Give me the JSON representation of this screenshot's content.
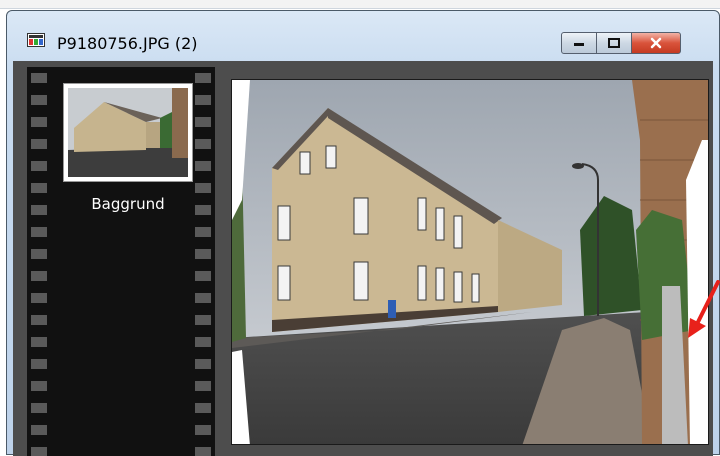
{
  "window": {
    "title": "P9180756.JPG (2)"
  },
  "controls": {
    "minimize_icon": "minimize-icon",
    "maximize_icon": "maximize-icon",
    "close_icon": "close-icon"
  },
  "layers": [
    {
      "label": "Baggrund"
    }
  ],
  "colors": {
    "close_button": "#d9533b",
    "filmstrip": "#111111",
    "workspace": "#4d4d4d",
    "annotation_arrow": "#e8211b"
  }
}
